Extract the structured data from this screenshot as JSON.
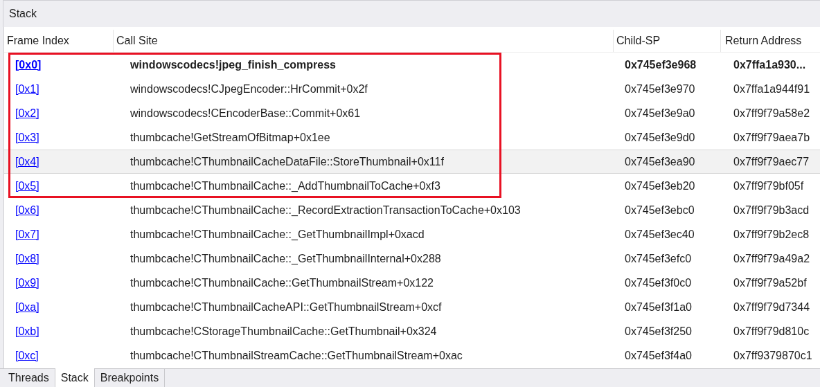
{
  "panel": {
    "title": "Stack"
  },
  "table": {
    "columns": [
      "Frame Index",
      "Call Site",
      "Child-SP",
      "Return Address"
    ],
    "rows": [
      {
        "index": "[0x0]",
        "call_site": "windowscodecs!jpeg_finish_compress",
        "child_sp": "0x745ef3e968",
        "return_address": "0x7ffa1a930...",
        "current": true,
        "selected": false,
        "in_red_box": true
      },
      {
        "index": "[0x1]",
        "call_site": "windowscodecs!CJpegEncoder::HrCommit+0x2f",
        "child_sp": "0x745ef3e970",
        "return_address": "0x7ffa1a944f91",
        "current": false,
        "selected": false,
        "in_red_box": true
      },
      {
        "index": "[0x2]",
        "call_site": "windowscodecs!CEncoderBase::Commit+0x61",
        "child_sp": "0x745ef3e9a0",
        "return_address": "0x7ff9f79a58e2",
        "current": false,
        "selected": false,
        "in_red_box": true
      },
      {
        "index": "[0x3]",
        "call_site": "thumbcache!GetStreamOfBitmap+0x1ee",
        "child_sp": "0x745ef3e9d0",
        "return_address": "0x7ff9f79aea7b",
        "current": false,
        "selected": false,
        "in_red_box": true
      },
      {
        "index": "[0x4]",
        "call_site": "thumbcache!CThumbnailCacheDataFile::StoreThumbnail+0x11f",
        "child_sp": "0x745ef3ea90",
        "return_address": "0x7ff9f79aec77",
        "current": false,
        "selected": true,
        "in_red_box": true
      },
      {
        "index": "[0x5]",
        "call_site": "thumbcache!CThumbnailCache::_AddThumbnailToCache+0xf3",
        "child_sp": "0x745ef3eb20",
        "return_address": "0x7ff9f79bf05f",
        "current": false,
        "selected": false,
        "in_red_box": true
      },
      {
        "index": "[0x6]",
        "call_site": "thumbcache!CThumbnailCache::_RecordExtractionTransactionToCache+0x103",
        "child_sp": "0x745ef3ebc0",
        "return_address": "0x7ff9f79b3acd",
        "current": false,
        "selected": false,
        "in_red_box": false
      },
      {
        "index": "[0x7]",
        "call_site": "thumbcache!CThumbnailCache::_GetThumbnailImpl+0xacd",
        "child_sp": "0x745ef3ec40",
        "return_address": "0x7ff9f79b2ec8",
        "current": false,
        "selected": false,
        "in_red_box": false
      },
      {
        "index": "[0x8]",
        "call_site": "thumbcache!CThumbnailCache::_GetThumbnailInternal+0x288",
        "child_sp": "0x745ef3efc0",
        "return_address": "0x7ff9f79a49a2",
        "current": false,
        "selected": false,
        "in_red_box": false
      },
      {
        "index": "[0x9]",
        "call_site": "thumbcache!CThumbnailCache::GetThumbnailStream+0x122",
        "child_sp": "0x745ef3f0c0",
        "return_address": "0x7ff9f79a52bf",
        "current": false,
        "selected": false,
        "in_red_box": false
      },
      {
        "index": "[0xa]",
        "call_site": "thumbcache!CThumbnailCacheAPI::GetThumbnailStream+0xcf",
        "child_sp": "0x745ef3f1a0",
        "return_address": "0x7ff9f79d7344",
        "current": false,
        "selected": false,
        "in_red_box": false
      },
      {
        "index": "[0xb]",
        "call_site": "thumbcache!CStorageThumbnailCache::GetThumbnail+0x324",
        "child_sp": "0x745ef3f250",
        "return_address": "0x7ff9f79d810c",
        "current": false,
        "selected": false,
        "in_red_box": false
      },
      {
        "index": "[0xc]",
        "call_site": "thumbcache!CThumbnailStreamCache::GetThumbnailStream+0xac",
        "child_sp": "0x745ef3f4a0",
        "return_address": "0x7ff9379870c1",
        "current": false,
        "selected": false,
        "in_red_box": false
      }
    ]
  },
  "tabs": [
    {
      "label": "Threads",
      "selected": false
    },
    {
      "label": "Stack",
      "selected": true
    },
    {
      "label": "Breakpoints",
      "selected": false
    }
  ]
}
